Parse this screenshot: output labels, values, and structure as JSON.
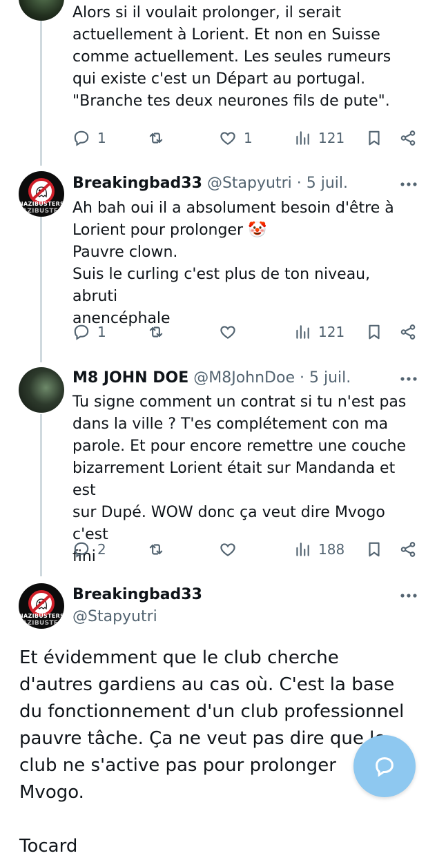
{
  "tweets": [
    {
      "text": "Alors si il voulait prolonger, il serait actuellement à Lorient. Et non en Suisse comme actuellement. Les seules rumeurs qui existe c'est un Départ au portugal. \"Branche tes deux neurones fils de pute\".",
      "replies": "1",
      "retweets": "",
      "likes": "1",
      "views": "121"
    },
    {
      "name": "Breakingbad33",
      "handle": "@Stapyutri",
      "sep": "·",
      "date": "5 juil.",
      "avatar_text": [
        "NAZIBUSTERS",
        "AZIBUSTEI"
      ],
      "text": "Ah bah oui il a absolument besoin d'être à\nLorient pour prolonger 🤡\nPauvre clown.\nSuis le curling c'est plus de ton niveau, abruti\nanencéphale",
      "replies": "1",
      "retweets": "",
      "likes": "",
      "views": "121"
    },
    {
      "name": "M8 JOHN DOE",
      "handle": "@M8JohnDoe",
      "sep": "·",
      "date": "5 juil.",
      "text": "Tu signe comment un contrat si tu n'est pas\ndans la ville ? T'es complétement con ma\nparole. Et pour encore remettre une couche\nbizarrement Lorient était sur Mandanda et est\nsur Dupé. WOW donc ça veut dire Mvogo c'est\nfini",
      "replies": "2",
      "retweets": "",
      "likes": "",
      "views": "188"
    }
  ],
  "main_tweet": {
    "name": "Breakingbad33",
    "handle": "@Stapyutri",
    "avatar_text": [
      "NAZIBUSTERS",
      "AZIBUSTEI"
    ],
    "paragraph1": "Et évidemment que le club cherche d'autres gardiens au cas où. C'est la base du fonctionnement d'un club professionnel pauvre tâche. Ça ne veut pas dire que le club ne s'active pas pour prolonger Mvogo.",
    "paragraph2": "Tocard"
  },
  "icons": {
    "reply": "reply-bubble-icon",
    "retweet": "retweet-icon",
    "like": "heart-icon",
    "views": "views-bar-icon",
    "bookmark": "bookmark-icon",
    "share": "share-icon",
    "more": "more-dots-icon",
    "fab": "compose-reply-icon"
  },
  "colors": {
    "accent": "#1d9bf0",
    "fab": "#8ec8f0",
    "muted": "#536471",
    "thread": "#cfd9de"
  }
}
